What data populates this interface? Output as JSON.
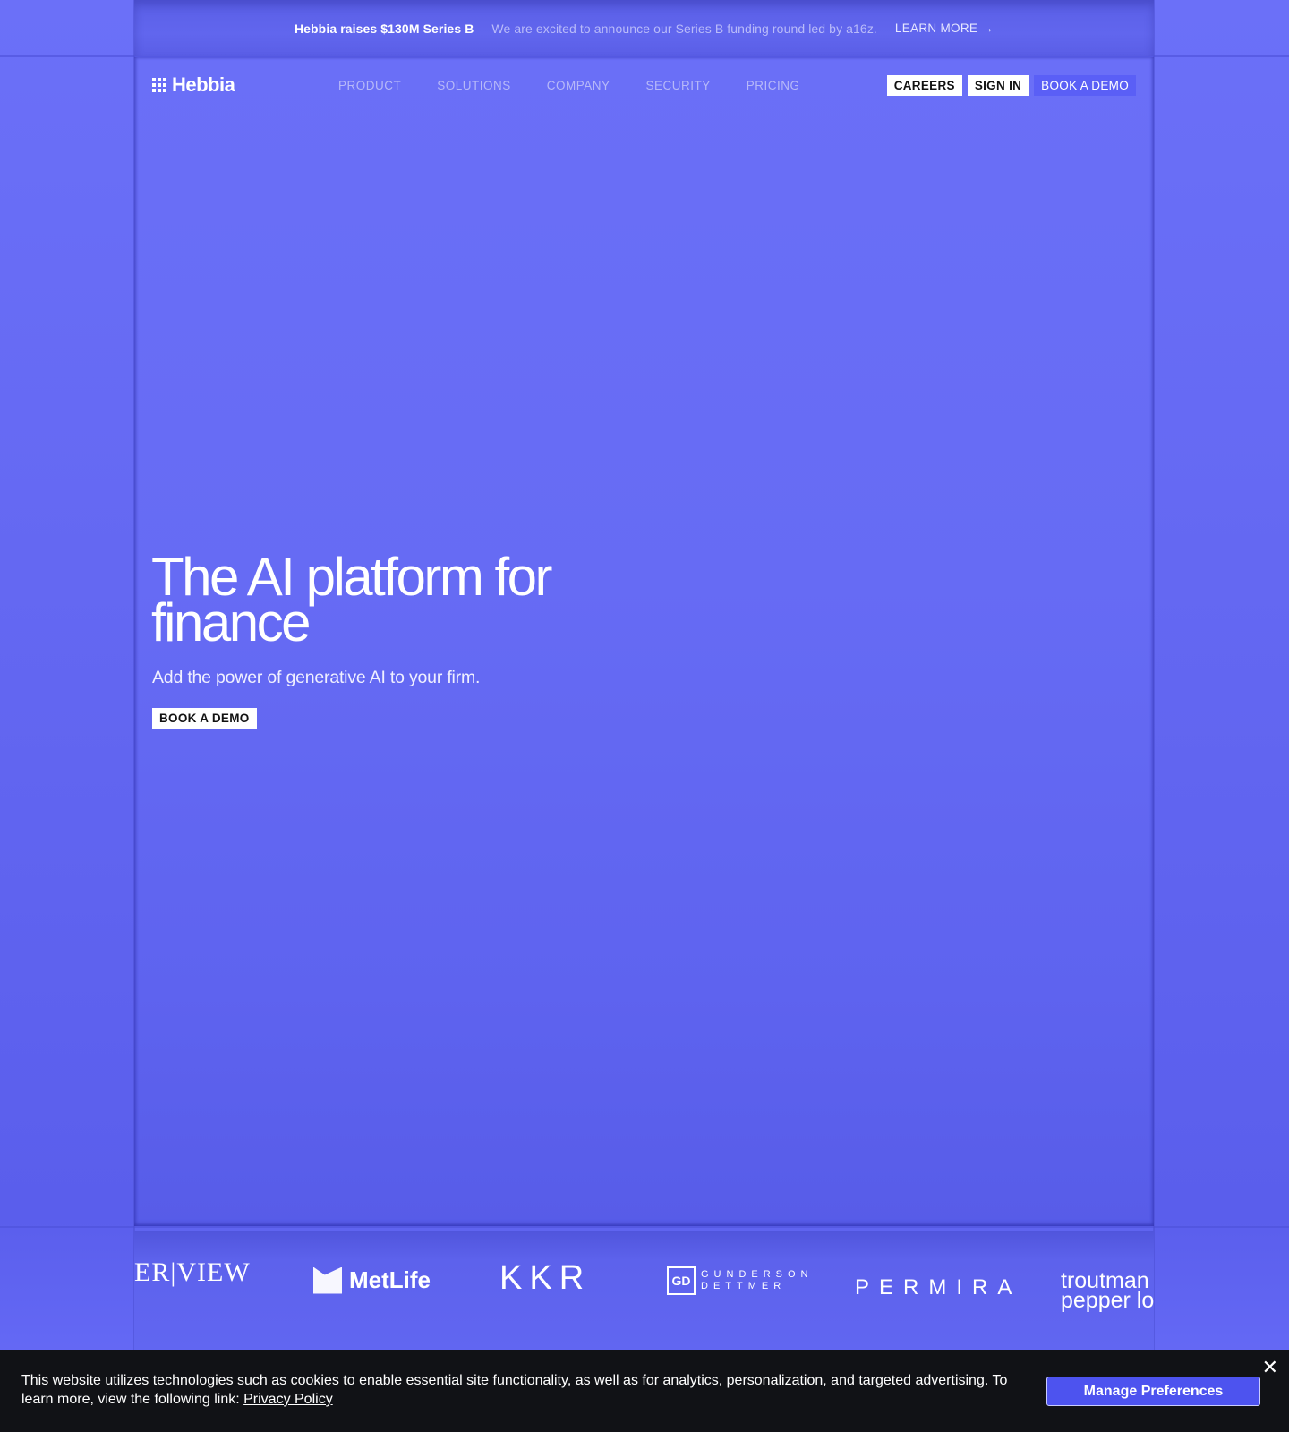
{
  "announcement": {
    "title": "Hebbia raises $130M Series B",
    "description": "We are excited to announce our Series B funding round led by a16z.",
    "link": "LEARN MORE →"
  },
  "header": {
    "logo_text": "Hebbia",
    "nav": [
      "PRODUCT",
      "SOLUTIONS",
      "COMPANY",
      "SECURITY",
      "PRICING"
    ],
    "careers": "CAREERS",
    "sign_in": "SIGN IN",
    "book_demo": "BOOK A DEMO"
  },
  "hero": {
    "title": "The AI platform for finance",
    "subtitle": "Add the power of generative AI to your firm.",
    "cta": "BOOK A DEMO"
  },
  "logos": {
    "riverview": "ER|VIEW",
    "metlife": "MetLife",
    "kkr": "KKR",
    "gunderson_mark": "GD",
    "gunderson_line1": "GUNDERSON",
    "gunderson_line2": "DETTMER",
    "permira": "PERMIRA",
    "troutman_line1": "troutman",
    "troutman_line2": "pepper lo"
  },
  "cookie": {
    "text": "This website utilizes technologies such as cookies to enable essential site functionality, as well as for analytics, personalization, and targeted advertising. To learn more, view the following link: ",
    "link": "Privacy Policy",
    "button": "Manage Preferences",
    "close": "✕"
  },
  "colors": {
    "brand": "#666bf4",
    "cookie_bg": "#111216",
    "manage_button": "#4d53ef"
  }
}
